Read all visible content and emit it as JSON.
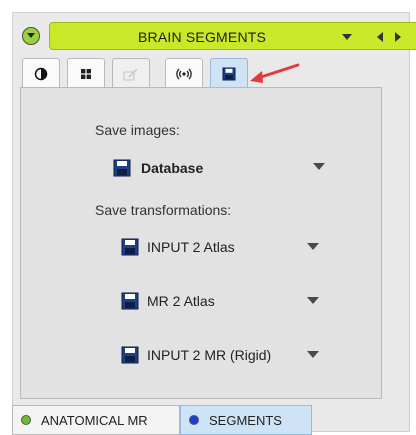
{
  "header": {
    "title": "BRAIN SEGMENTS",
    "icons": [
      "chevron-down-icon",
      "dropdown-icon",
      "prev-icon",
      "next-icon"
    ],
    "accent_color": "#c9e82a"
  },
  "tabs": [
    {
      "name": "contrast-tab",
      "icon": "contrast-icon",
      "state": "normal"
    },
    {
      "name": "grid-tab",
      "icon": "grid-icon",
      "state": "normal"
    },
    {
      "name": "edit-tab",
      "icon": "edit-icon",
      "state": "disabled"
    },
    {
      "name": "broadcast-tab",
      "icon": "broadcast-icon",
      "state": "normal"
    },
    {
      "name": "save-tab",
      "icon": "floppy-icon",
      "state": "active"
    }
  ],
  "save_panel": {
    "save_images_label": "Save images:",
    "database_label": "Database",
    "save_transformations_label": "Save transformations:",
    "transformations": [
      {
        "label": "INPUT 2 Atlas"
      },
      {
        "label": "MR 2 Atlas"
      },
      {
        "label": "INPUT 2 MR (Rigid)"
      }
    ]
  },
  "bottom_tabs": [
    {
      "label": "ANATOMICAL MR",
      "dot_color": "#6cbf2a"
    },
    {
      "label": "SEGMENTS",
      "dot_color": "#1a3fd6"
    }
  ]
}
